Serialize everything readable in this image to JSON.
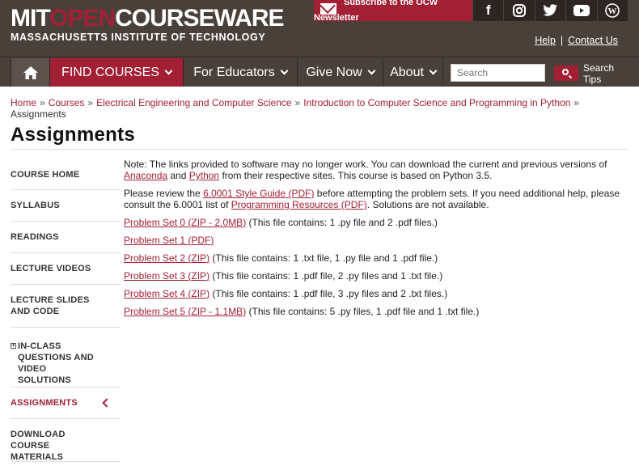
{
  "header": {
    "logo_part1": "MIT",
    "logo_part2": "OPEN",
    "logo_part3": "COURSEWARE",
    "logo_sub": "MASSACHUSETTS INSTITUTE OF TECHNOLOGY",
    "newsletter_label": "Subscribe to the OCW",
    "newsletter_label2": "Newsletter",
    "help_label": "Help",
    "contact_label": "Contact Us",
    "accent_color": "#a31f34",
    "social": [
      "facebook-icon",
      "instagram-icon",
      "twitter-icon",
      "youtube-icon",
      "wordpress-icon"
    ]
  },
  "nav": {
    "find_courses": "FIND COURSES",
    "for_educators": "For Educators",
    "give_now": "Give Now",
    "about": "About",
    "search_placeholder": "Search",
    "search_tips": "Search Tips"
  },
  "breadcrumb": {
    "items": [
      "Home",
      "Courses",
      "Electrical Engineering and Computer Science",
      "Introduction to Computer Science and Programming in Python"
    ],
    "current": "Assignments"
  },
  "page_title": "Assignments",
  "sidebar": {
    "items": [
      {
        "label": "COURSE HOME"
      },
      {
        "label": "SYLLABUS"
      },
      {
        "label": "READINGS"
      },
      {
        "label": "LECTURE VIDEOS"
      },
      {
        "label": "LECTURE SLIDES AND CODE"
      },
      {
        "label": "IN-CLASS QUESTIONS AND VIDEO SOLUTIONS"
      },
      {
        "label": "ASSIGNMENTS"
      },
      {
        "label": "DOWNLOAD COURSE MATERIALS"
      }
    ]
  },
  "content": {
    "note": {
      "t1": "Note: The links provided to software may no longer work. You can download the current and previous versions of ",
      "anaconda": "Anaconda",
      "t2": " and ",
      "python": "Python",
      "t3": " from their respective sites. This course is based on Python 3.5."
    },
    "review": {
      "t1": "Please review the ",
      "style_guide": "6.0001 Style Guide (PDF)",
      "t2": " before attempting the problem sets. If you need additional help, please consult the 6.0001 list of ",
      "resources": "Programming Resources (PDF)",
      "t3": ". Solutions are not available."
    },
    "problem_sets": [
      {
        "title": "Problem Set 0",
        "link": "ZIP - 2.0MB",
        "desc": "(This file contains: 1 .py file and 2 .pdf files.)"
      },
      {
        "title": "Problem Set 1",
        "link": "PDF",
        "desc": ""
      },
      {
        "title": "Problem Set 2",
        "link": "ZIP",
        "desc": "(This file contains: 1 .txt file, 1 .py file and 1 .pdf file.)"
      },
      {
        "title": "Problem Set 3",
        "link": "ZIP",
        "desc": "(This file contains: 1 .pdf file, 2 .py files and 1 .txt file.)"
      },
      {
        "title": "Problem Set 4",
        "link": "ZIP",
        "desc": "(This file contains: 1 .pdf file, 3 .py files and  2 .txt files.)"
      },
      {
        "title": "Problem Set 5",
        "link": "ZIP - 1.1MB",
        "desc": "(This file contains: 5 .py files, 1 .pdf file and 1 .txt file.)"
      }
    ]
  }
}
